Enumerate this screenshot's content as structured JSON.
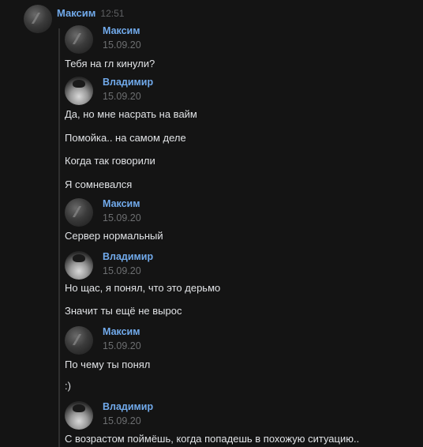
{
  "header": {
    "sender": "Максим",
    "time": "12:51"
  },
  "thread": [
    {
      "kind": "author",
      "name": "Максим",
      "date": "15.09.20",
      "avatar": "maksim"
    },
    {
      "kind": "text",
      "text": "Тебя на гл кинули?"
    },
    {
      "kind": "author",
      "name": "Владимир",
      "date": "15.09.20",
      "avatar": "vlad"
    },
    {
      "kind": "text",
      "text": "Да, но мне насрать на вайм"
    },
    {
      "kind": "text",
      "text": "Помойка.. на самом деле"
    },
    {
      "kind": "text",
      "text": "Когда так говорили"
    },
    {
      "kind": "text",
      "text": "Я сомневался"
    },
    {
      "kind": "author",
      "name": "Максим",
      "date": "15.09.20",
      "avatar": "maksim"
    },
    {
      "kind": "text",
      "text": "Сервер нормальный"
    },
    {
      "kind": "author",
      "name": "Владимир",
      "date": "15.09.20",
      "avatar": "vlad"
    },
    {
      "kind": "text",
      "text": "Но щас, я понял, что это дерьмо"
    },
    {
      "kind": "text",
      "text": "Значит ты ещё не вырос"
    },
    {
      "kind": "author",
      "name": "Максим",
      "date": "15.09.20",
      "avatar": "maksim"
    },
    {
      "kind": "text",
      "text": "По чему ты понял"
    },
    {
      "kind": "text",
      "text": ":)"
    },
    {
      "kind": "author",
      "name": "Владимир",
      "date": "15.09.20",
      "avatar": "vlad"
    },
    {
      "kind": "text",
      "text": "С возрастом поймёшь, когда попадешь в похожую ситуацию.."
    }
  ]
}
